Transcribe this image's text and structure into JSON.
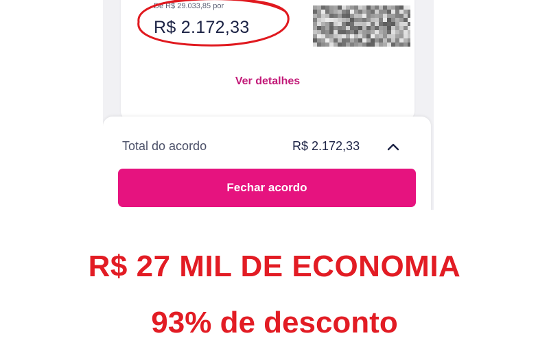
{
  "offer": {
    "old_price": "De R$ 29.033,85 por",
    "new_price": "R$ 2.172,33",
    "details_link": "Ver detalhes"
  },
  "summary": {
    "total_label": "Total do acordo",
    "total_value": "R$ 2.172,33",
    "close_button": "Fechar acordo"
  },
  "promo": {
    "headline": "R$ 27 MIL DE ECONOMIA",
    "subheadline": "93% de desconto"
  },
  "colors": {
    "accent": "#e6137f",
    "link": "#c21a78",
    "promo_red": "#e21c24",
    "annotation_red": "#e0191f"
  },
  "icons": {
    "chevron": "chevron-up-icon",
    "blur": "blurred-image"
  }
}
